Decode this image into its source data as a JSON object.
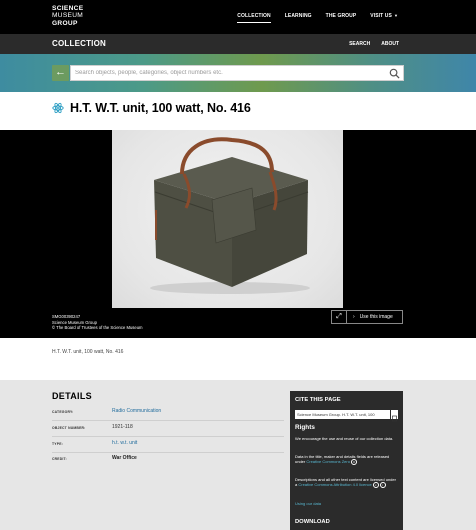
{
  "nav": {
    "logo_line1": "SCIENCE",
    "logo_line2": "MUSEUM",
    "logo_line3": "GROUP",
    "links": [
      "COLLECTION",
      "LEARNING",
      "THE GROUP",
      "VISIT US"
    ],
    "active": "COLLECTION"
  },
  "collection_bar": {
    "title": "COLLECTION",
    "search_label": "SEARCH",
    "about_label": "ABOUT"
  },
  "search": {
    "placeholder": "Search objects, people, categories, object numbers etc.",
    "accent": "#6c9b60"
  },
  "object": {
    "title": "H.T. W.T. unit, 100 watt, No. 416"
  },
  "image_credits": {
    "id": "SMG00390247",
    "owner": "Science Museum Group",
    "copyright": "© The Board of Trustees of the Science Museum"
  },
  "image_actions": {
    "use_label": "Use this image"
  },
  "breadcrumb": "H.T. W.T. unit, 100 watt, No. 416",
  "details": {
    "heading": "DETAILS",
    "rows": [
      {
        "key": "CATEGORY:",
        "value": "Radio Communication"
      },
      {
        "key": "OBJECT NUMBER:",
        "value": "1921-118"
      },
      {
        "key": "TYPE:",
        "value": "h.t. w.t. unit"
      },
      {
        "key": "CREDIT:",
        "value": "War Office"
      }
    ]
  },
  "cite": {
    "heading": "CITE THIS PAGE",
    "input_value": "Science Museum Group. H.T. W.T. unit, 100",
    "rights_heading": "Rights",
    "p1": "We encourage the use and reuse of our collection data.",
    "p2_text": "Data in the title, maker and details fields are released under ",
    "p2_link": "Creative Commons Zero",
    "p3_text": "Descriptions and all other text content are licensed under a ",
    "p3_link": "Creative Commons Attribution 4.0 licence",
    "p4_link": "Using our data"
  },
  "download": {
    "heading": "DOWNLOAD"
  }
}
